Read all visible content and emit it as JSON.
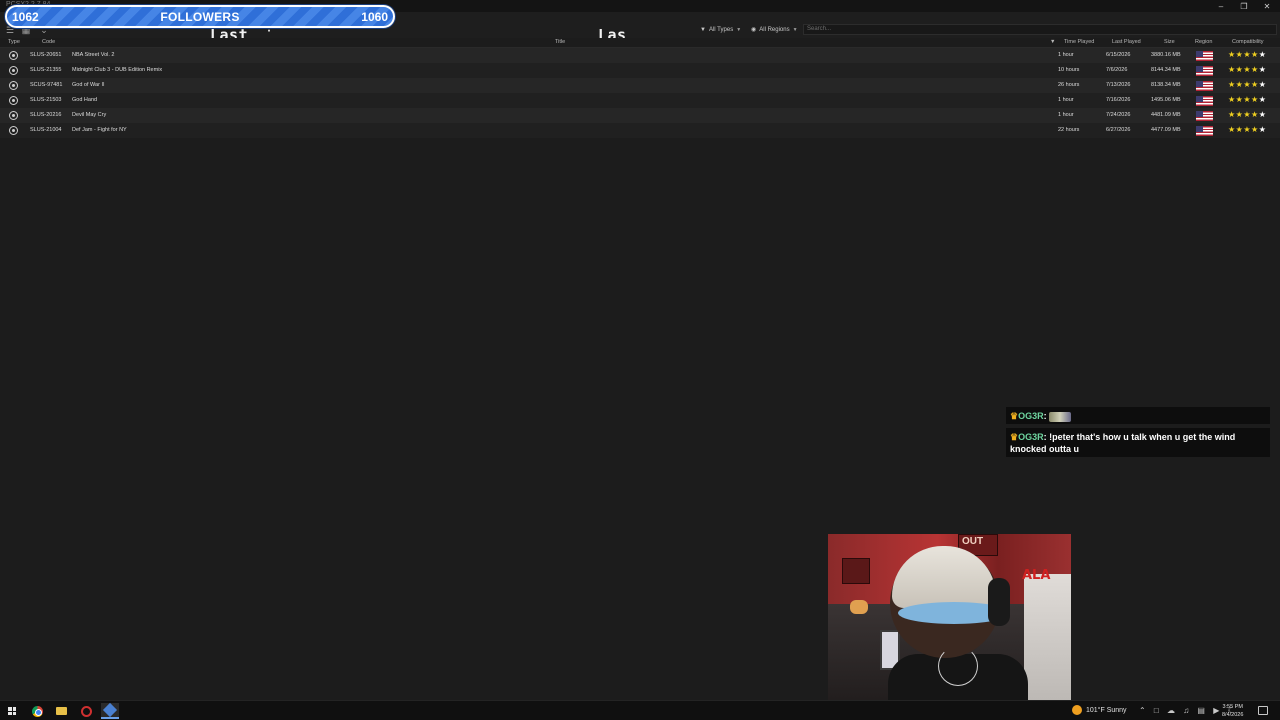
{
  "window": {
    "title": "PCSX2 2.7.84",
    "controls": [
      "minimize-icon",
      "maximize-icon",
      "close-icon"
    ]
  },
  "toolbar": {
    "type_filter": "All Types",
    "region_filter": "All Regions",
    "search_placeholder": "Search..."
  },
  "overlay_text": {
    "left": "Last",
    "dot": "·",
    "right": "Las"
  },
  "followers": {
    "current": "1062",
    "label": "FOLLOWERS",
    "goal": "1060",
    "color": "#3a78de"
  },
  "table": {
    "headers": {
      "type": "Type",
      "code": "Code",
      "title": "Title",
      "time_played": "Time Played",
      "last_played": "Last Played",
      "size": "Size",
      "region": "Region",
      "compatibility": "Compatibility"
    },
    "rows": [
      {
        "code": "SLUS-20651",
        "title": "NBA Street Vol. 2",
        "time_played": "1 hour",
        "last_played": "6/15/2026",
        "size": "3880.16 MB",
        "region": "us-flag-icon",
        "compatibility": 5
      },
      {
        "code": "SLUS-21355",
        "title": "Midnight Club 3 - DUB Edition Remix",
        "time_played": "10 hours",
        "last_played": "7/6/2026",
        "size": "8144.34 MB",
        "region": "us-flag-icon",
        "compatibility": 5
      },
      {
        "code": "SCUS-97481",
        "title": "God of War II",
        "time_played": "26 hours",
        "last_played": "7/13/2026",
        "size": "8138.34 MB",
        "region": "us-flag-icon",
        "compatibility": 5
      },
      {
        "code": "SLUS-21503",
        "title": "God Hand",
        "time_played": "1 hour",
        "last_played": "7/16/2026",
        "size": "1495.06 MB",
        "region": "us-flag-icon",
        "compatibility": 5
      },
      {
        "code": "SLUS-20216",
        "title": "Devil May Cry",
        "time_played": "1 hour",
        "last_played": "7/24/2026",
        "size": "4481.09 MB",
        "region": "us-flag-icon",
        "compatibility": 5
      },
      {
        "code": "SLUS-21004",
        "title": "Def Jam - Fight for NY",
        "time_played": "22 hours",
        "last_played": "6/27/2026",
        "size": "4477.09 MB",
        "region": "us-flag-icon",
        "compatibility": 5
      }
    ]
  },
  "chat": [
    {
      "user": "OG3R",
      "separator": ":",
      "message": ""
    },
    {
      "user": "OG3R",
      "separator": ":",
      "message": "!peter that's how u talk when u get the wind knocked outta u"
    }
  ],
  "webcam": {
    "poster_text": "ALA",
    "poster_top_text": "OUT"
  },
  "taskbar": {
    "apps": [
      "windows-start-icon",
      "chrome-icon",
      "file-explorer-icon",
      "recorder-icon",
      "pcsx2-icon"
    ],
    "weather": "101°F  Sunny",
    "time": "3:55 PM",
    "date": "8/4/2026"
  }
}
